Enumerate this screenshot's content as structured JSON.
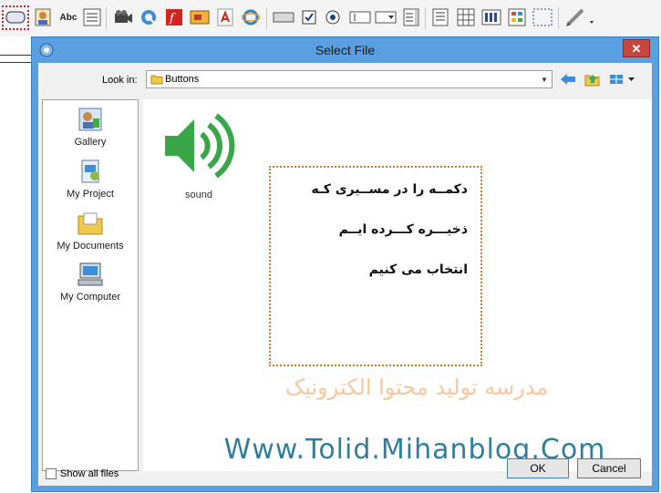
{
  "dialog": {
    "title": "Select File",
    "close_label": "✕",
    "look_in_label": "Look in:",
    "look_in_value": "Buttons",
    "show_all_files_label": "Show all files",
    "ok_label": "OK",
    "cancel_label": "Cancel"
  },
  "places": [
    {
      "label": "Gallery",
      "icon": "gallery-icon"
    },
    {
      "label": "My Project",
      "icon": "project-icon"
    },
    {
      "label": "My Documents",
      "icon": "documents-icon"
    },
    {
      "label": "My Computer",
      "icon": "computer-icon"
    }
  ],
  "files": [
    {
      "label": "sound",
      "icon": "speaker-icon"
    }
  ],
  "note": {
    "line1": "دکمــه را در مســیری کـه",
    "line2": "ذخیـــره کـــرده ایــم",
    "line3": "انتخاب می کنیم"
  },
  "watermark": {
    "persian": "مدرسه تولید محتوا الکترونیک",
    "url": "Www.Tolid.Mihanblog.Com"
  },
  "toolbar": {
    "abc_label": "Abc"
  },
  "colors": {
    "dialog_frame": "#5a9fe0",
    "close_button": "#c7463e",
    "note_border": "#d77a22",
    "watermark_persian": "#f6c8a2",
    "watermark_url": "#2f7f9a",
    "speaker": "#3aa64a"
  }
}
